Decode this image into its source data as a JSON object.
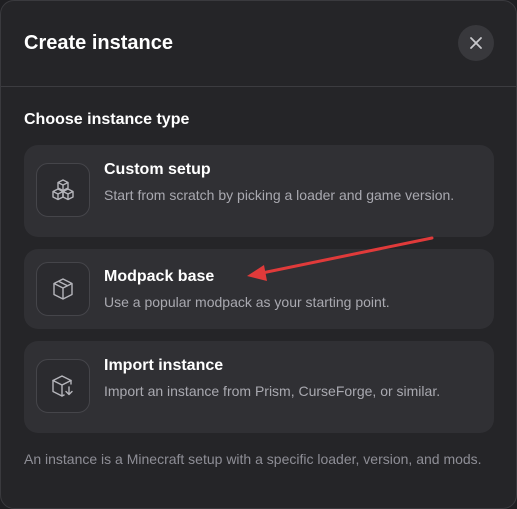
{
  "dialog": {
    "title": "Create instance",
    "close_icon": "close-icon"
  },
  "section": {
    "heading": "Choose instance type"
  },
  "options": [
    {
      "title": "Custom setup",
      "description": "Start from scratch by picking a loader and game version.",
      "icon": "cubes-icon"
    },
    {
      "title": "Modpack base",
      "description": "Use a popular modpack as your starting point.",
      "icon": "box-icon"
    },
    {
      "title": "Import instance",
      "description": "Import an instance from Prism, CurseForge, or similar.",
      "icon": "box-import-icon"
    }
  ],
  "footnote": "An instance is a Minecraft setup with a specific loader, version, and mods.",
  "colors": {
    "background": "#252528",
    "card": "#303034",
    "annotation_arrow": "#e03a3a"
  }
}
